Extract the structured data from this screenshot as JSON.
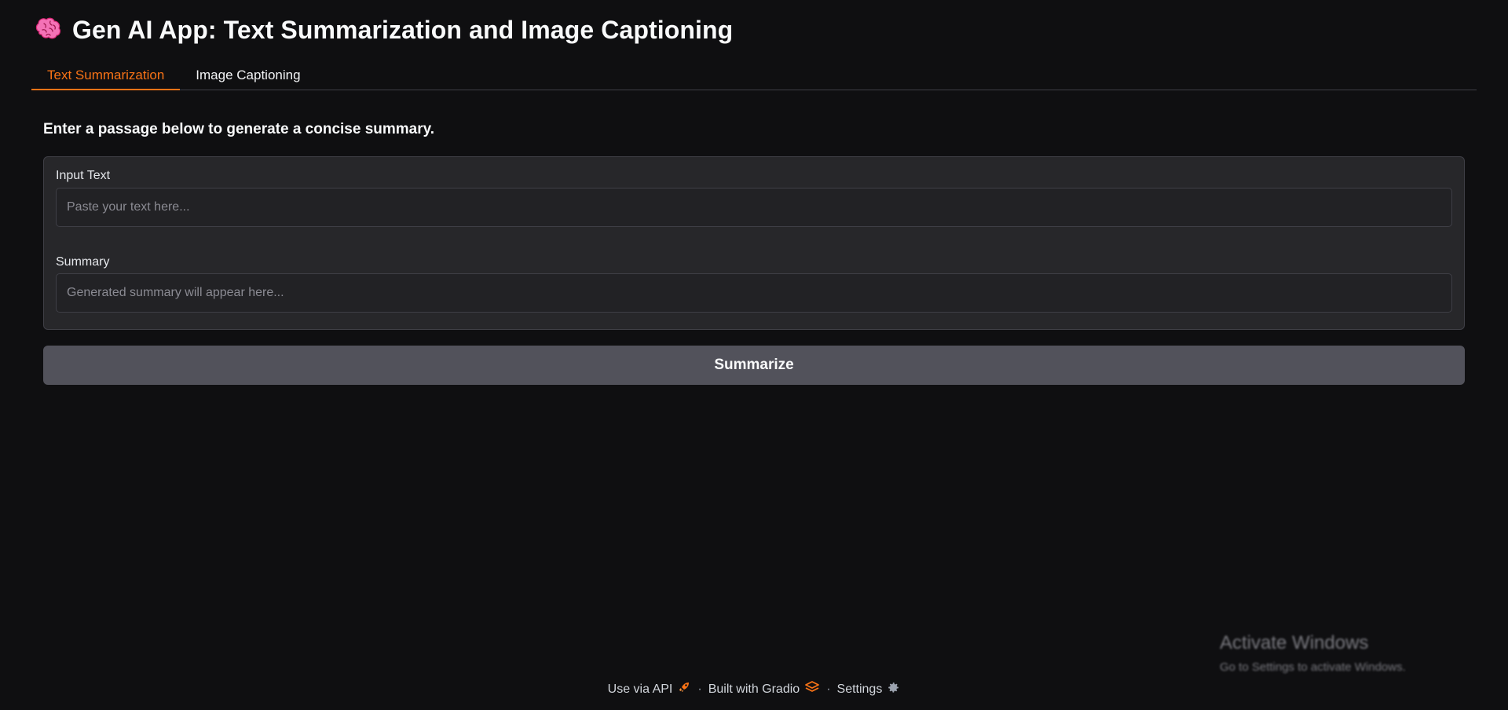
{
  "app": {
    "title": "Gen AI App: Text Summarization and Image Captioning",
    "title_icon": "brain-icon",
    "accent_color": "#f97316"
  },
  "tabs": [
    {
      "label": "Text Summarization",
      "active": true
    },
    {
      "label": "Image Captioning",
      "active": false
    }
  ],
  "summarization": {
    "intro": "Enter a passage below to generate a concise summary.",
    "input": {
      "label": "Input Text",
      "placeholder": "Paste your text here...",
      "value": ""
    },
    "output": {
      "label": "Summary",
      "placeholder": "Generated summary will appear here...",
      "value": ""
    },
    "button_label": "Summarize"
  },
  "footer": {
    "api_label": "Use via API",
    "api_icon": "rocket-icon",
    "built_label": "Built with Gradio",
    "built_icon": "gradio-logo-icon",
    "settings_label": "Settings",
    "settings_icon": "gear-icon",
    "separator": "·"
  },
  "watermark": {
    "title": "Activate Windows",
    "subtitle": "Go to Settings to activate Windows."
  }
}
